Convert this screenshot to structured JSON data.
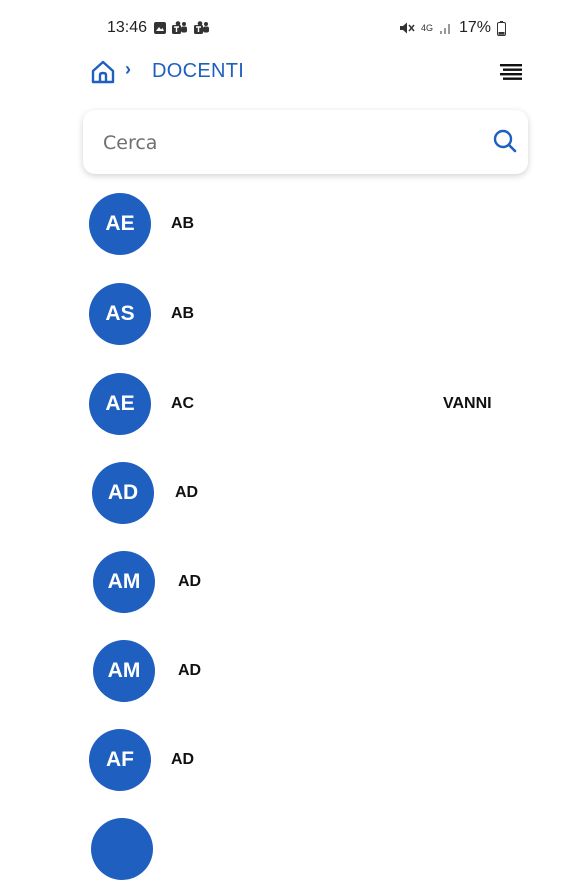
{
  "status_bar": {
    "time": "13:46",
    "left_icons": [
      "gallery-icon",
      "teams-icon",
      "teams-icon"
    ],
    "right_icons": [
      "mute-icon",
      "4g-icon",
      "signal-icon"
    ],
    "network_label": "4G",
    "battery_text": "17%"
  },
  "header": {
    "home_icon": "home-icon",
    "separator": "›",
    "title": "DOCENTI",
    "menu_icon": "menu-icon"
  },
  "search": {
    "placeholder": "Cerca",
    "value": "",
    "icon": "search-icon"
  },
  "teachers": [
    {
      "initials": "AE",
      "name": "AB",
      "name_tail": ""
    },
    {
      "initials": "AS",
      "name": "AB",
      "name_tail": ""
    },
    {
      "initials": "AE",
      "name": "AC",
      "name_tail": "VANNI"
    },
    {
      "initials": "AD",
      "name": "AD",
      "name_tail": ""
    },
    {
      "initials": "AM",
      "name": "AD",
      "name_tail": ""
    },
    {
      "initials": "AM",
      "name": "AD",
      "name_tail": ""
    },
    {
      "initials": "AF",
      "name": "AD",
      "name_tail": ""
    },
    {
      "initials": "",
      "name": "",
      "name_tail": ""
    }
  ],
  "colors": {
    "accent": "#1e5fbf",
    "text": "#111111",
    "background": "#ffffff"
  }
}
